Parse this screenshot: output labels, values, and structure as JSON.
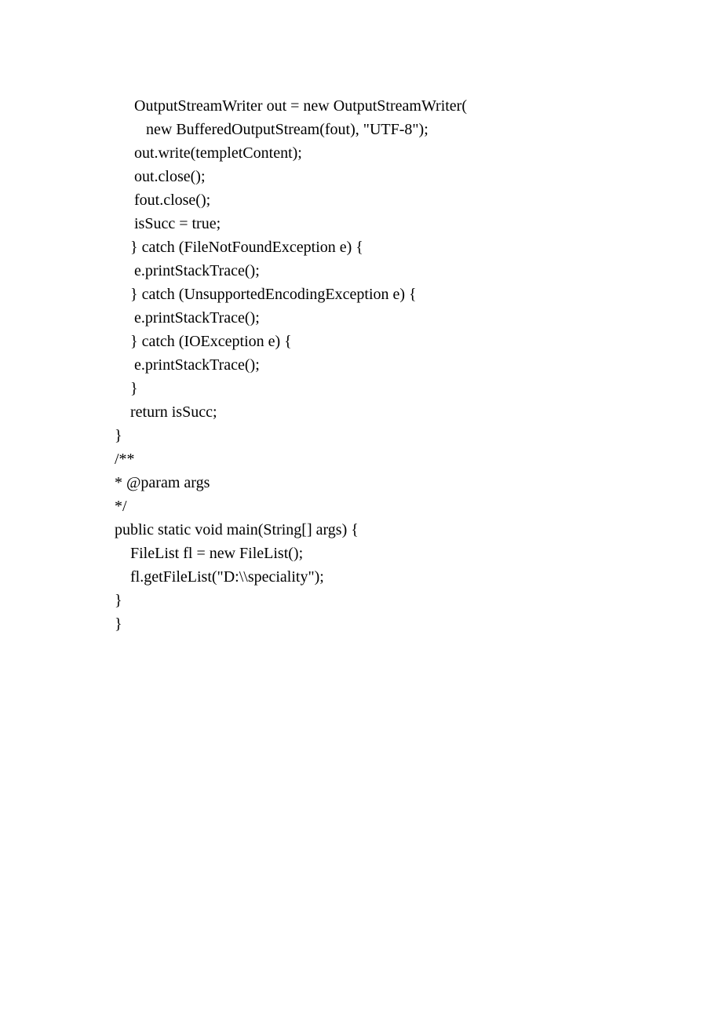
{
  "code": {
    "lines": [
      "     OutputStreamWriter out = new OutputStreamWriter(",
      "        new BufferedOutputStream(fout), \"UTF-8\");",
      "     out.write(templetContent);",
      "     out.close();",
      "     fout.close();",
      "     isSucc = true;",
      "    } catch (FileNotFoundException e) {",
      "     e.printStackTrace();",
      "    } catch (UnsupportedEncodingException e) {",
      "     e.printStackTrace();",
      "    } catch (IOException e) {",
      "     e.printStackTrace();",
      "    }",
      "    return isSucc;",
      "}",
      "/**",
      "* @param args",
      "*/",
      "public static void main(String[] args) {",
      "    FileList fl = new FileList();",
      "    fl.getFileList(\"D:\\\\speciality\");",
      "}",
      "}"
    ]
  }
}
